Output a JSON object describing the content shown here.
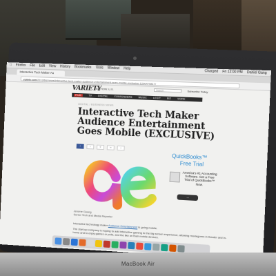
{
  "menubar": {
    "items": [
      "Firefox",
      "File",
      "Edit",
      "View",
      "History",
      "Bookmarks",
      "Tools",
      "Window",
      "Help"
    ],
    "status": "Charged",
    "clock": "Fri 12:00 PM",
    "user": "Daniel Gang"
  },
  "tab": {
    "title": "Interactive Tech Maker Au"
  },
  "address": {
    "host": "variety.com",
    "path": "/2013/biz/news/interactive-tech-maker-audience-entertainment-goes-mobile-exclusive-1200479817/"
  },
  "site": {
    "logo": "VARIETY",
    "edition": "EDITION: U.S.",
    "search_placeholder": "Search",
    "subscribe": "Subscribe Today",
    "nav": [
      "FILM",
      "TV",
      "DIGITAL",
      "CONTENDERS",
      "MUSIC",
      "LEGIT",
      "BIZ",
      "MORE"
    ]
  },
  "article": {
    "breadcrumb": "DIGITAL / BUSINESS NEWS",
    "headline": "Interactive Tech Maker Audience Entertainment Goes Mobile (EXCLUSIVE)",
    "share": {
      "facebook": "f",
      "twitter": "t",
      "count": "0",
      "email": "in",
      "plus": "+"
    },
    "byline": "Jerome Guang",
    "byline_detail": "Senior Tech and Media Reporter",
    "intro": "Interactive technology maker",
    "intro_link": "Audience Entertainment",
    "intro_rest": "is going mobile.",
    "para2": "The start-up company is hoping to add interactive gaming to the big screen experience, allowing moviegoers in theater and in-home and to enjoy games or polls, and the like on their mobile devices."
  },
  "ad": {
    "brand": "QuickBooks™",
    "trial": "Free Trial",
    "copy": "America's #1 Accounting Software. Get a Free Trial of QuickBooks™ Now.",
    "button": "→"
  },
  "device": {
    "model": "MacBook Air"
  },
  "colors": {
    "variety_red": "#c6312a",
    "ad_blue": "#2a8ad0",
    "screen_bg": "#f1f1ef"
  }
}
